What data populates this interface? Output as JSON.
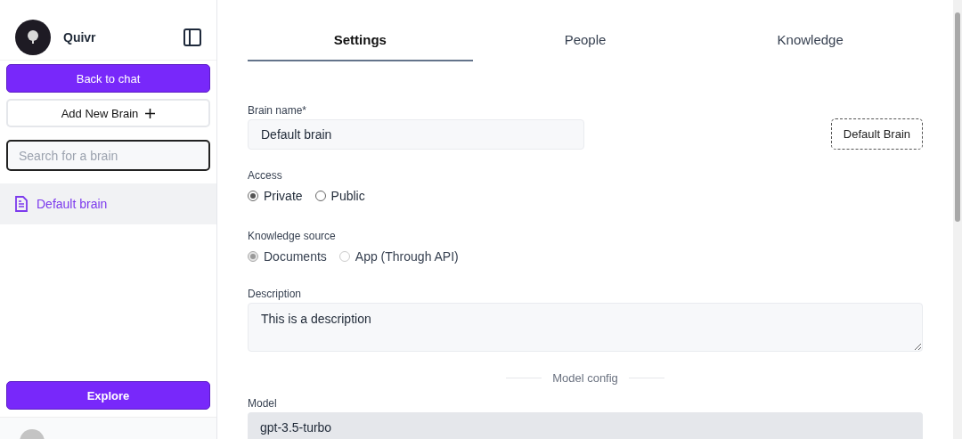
{
  "sidebar": {
    "app_name": "Quivr",
    "buttons": [
      {
        "label": "Back to chat",
        "kind": "primary"
      },
      {
        "label": "Add New Brain",
        "kind": "add"
      }
    ],
    "search": {
      "placeholder": "Search for a brain"
    },
    "brains": [
      {
        "label": "Default brain",
        "selected": true
      }
    ],
    "explore": {
      "label": "Explore"
    }
  },
  "tabs": [
    {
      "label": "Settings",
      "selected": true
    },
    {
      "label": "People",
      "selected": false
    },
    {
      "label": "Knowledge",
      "selected": false
    }
  ],
  "form": {
    "brain_name": {
      "label": "Brain name*",
      "value": "Default brain"
    },
    "set_default_button": "Default Brain",
    "access": {
      "label": "Access",
      "disabled": false,
      "options": [
        {
          "label": "Private",
          "selected": true
        },
        {
          "label": "Public",
          "selected": false
        }
      ]
    },
    "knowledge_source": {
      "label": "Knowledge source",
      "disabled": true,
      "options": [
        {
          "label": "Documents",
          "selected": true
        },
        {
          "label": "App (Through API)",
          "selected": false
        }
      ]
    },
    "description": {
      "label": "Description",
      "value": "This is a description"
    },
    "section_title": "Model config",
    "model": {
      "label": "Model",
      "value": "gpt-3.5-turbo"
    }
  }
}
